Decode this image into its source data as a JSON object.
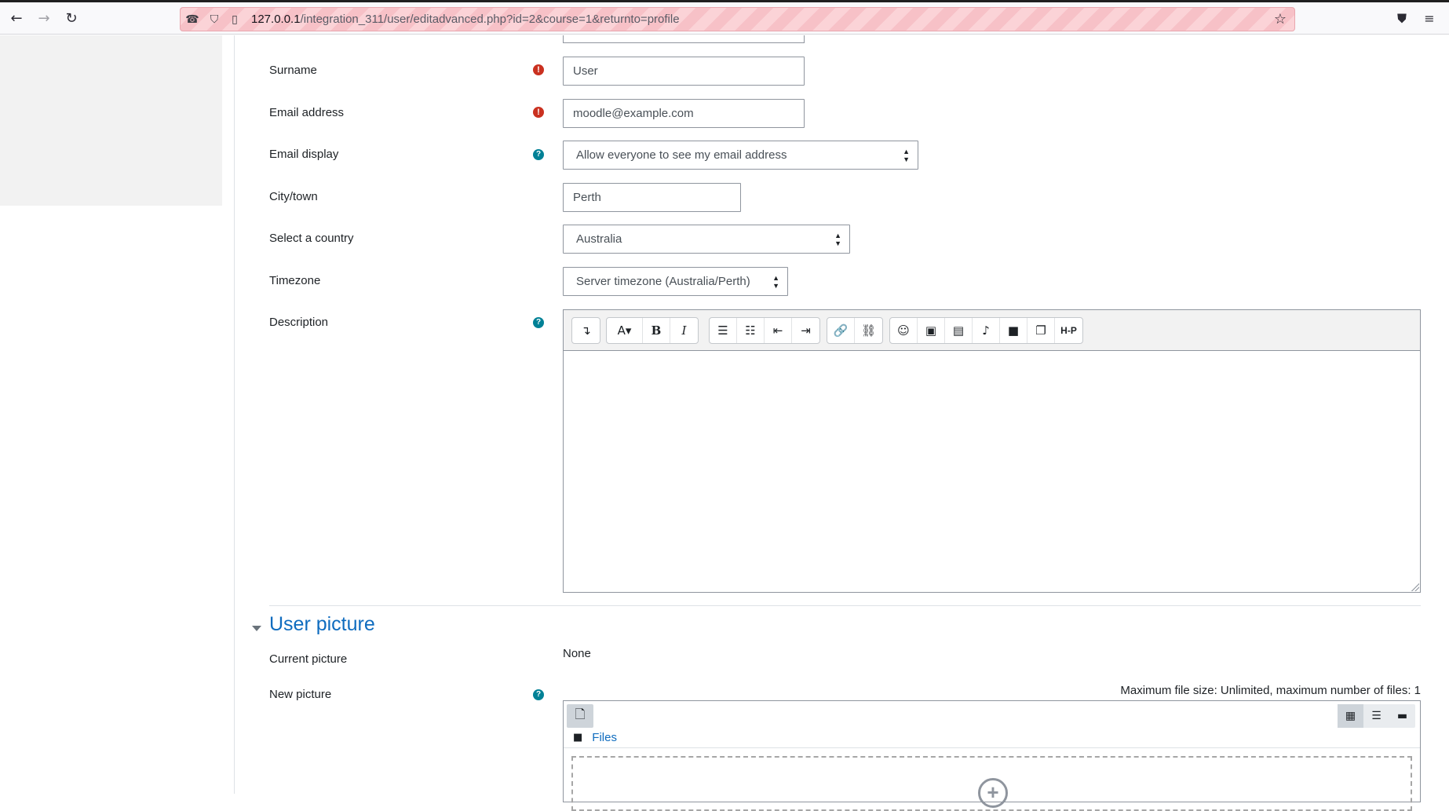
{
  "browser": {
    "url_host": "127.0.0.1",
    "url_path": "/integration_311/user/editadvanced.php?id=2&course=1&returnto=profile",
    "back_icon": "arrow-left-icon",
    "forward_icon": "arrow-right-icon",
    "reload_icon": "reload-icon"
  },
  "form": {
    "surname": {
      "label": "Surname",
      "value": "User"
    },
    "email": {
      "label": "Email address",
      "value": "moodle@example.com"
    },
    "email_display": {
      "label": "Email display",
      "value": "Allow everyone to see my email address"
    },
    "city": {
      "label": "City/town",
      "value": "Perth"
    },
    "country": {
      "label": "Select a country",
      "value": "Australia"
    },
    "timezone": {
      "label": "Timezone",
      "value": "Server timezone (Australia/Perth)"
    },
    "description": {
      "label": "Description",
      "value": ""
    }
  },
  "editor_toolbar": {
    "groups": [
      [
        "collapse-icon"
      ],
      [
        "font-style-icon",
        "bold-icon",
        "italic-icon"
      ],
      [
        "unordered-list-icon",
        "ordered-list-icon",
        "outdent-icon",
        "indent-icon"
      ],
      [
        "link-icon",
        "unlink-icon"
      ],
      [
        "emoji-icon",
        "image-icon",
        "media-icon",
        "record-audio-icon",
        "record-video-icon",
        "manage-files-icon",
        "h5p-icon"
      ]
    ],
    "h5p_label": "H-P"
  },
  "user_picture": {
    "section_title": "User picture",
    "current_label": "Current picture",
    "current_value": "None",
    "new_label": "New picture",
    "file_limits": "Maximum file size: Unlimited, maximum number of files: 1",
    "files_link": "Files"
  },
  "colors": {
    "required": "#ca3120",
    "help": "#008196",
    "link": "#0f6cbf",
    "url_stripe": "#fbd3d7"
  }
}
